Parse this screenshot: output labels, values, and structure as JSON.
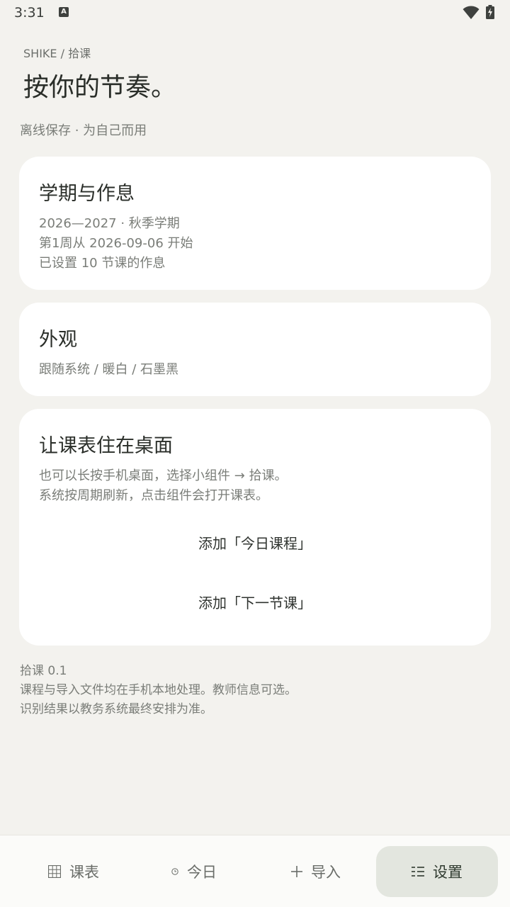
{
  "status_bar": {
    "time": "3:31",
    "notification_icon": "A"
  },
  "header": {
    "breadcrumb": "SHIKE / 拾课",
    "title": "按你的节奏。",
    "subtitle": "离线保存 · 为自己而用"
  },
  "term_card": {
    "title": "学期与作息",
    "semester": "2026—2027 · 秋季学期",
    "week_start": "第1周从 2026-09-06 开始",
    "schedule": "已设置 10 节课的作息"
  },
  "appearance_card": {
    "title": "外观",
    "options": "跟随系统 / 暖白 / 石墨黑"
  },
  "widget_card": {
    "title": "让课表住在桌面",
    "line1": "也可以长按手机桌面，选择小组件 → 拾课。",
    "line2": "系统按周期刷新，点击组件会打开课表。",
    "button_today": "添加「今日课程」",
    "button_next": "添加「下一节课」"
  },
  "footer": {
    "version": "拾课 0.1",
    "privacy": "课程与导入文件均在手机本地处理。教师信息可选。",
    "disclaimer": "识别结果以教务系统最终安排为准。"
  },
  "bottom_nav": {
    "items": [
      {
        "label": "课表",
        "icon": "grid-icon",
        "active": false
      },
      {
        "label": "今日",
        "icon": "clock-icon",
        "active": false
      },
      {
        "label": "导入",
        "icon": "plus-icon",
        "active": false
      },
      {
        "label": "设置",
        "icon": "list-icon",
        "active": true
      }
    ]
  },
  "colors": {
    "background": "#f3f2ee",
    "card": "#ffffff",
    "active_tab": "#e3e6df",
    "text_primary": "#2a2e29",
    "text_secondary": "#7a7d78"
  }
}
